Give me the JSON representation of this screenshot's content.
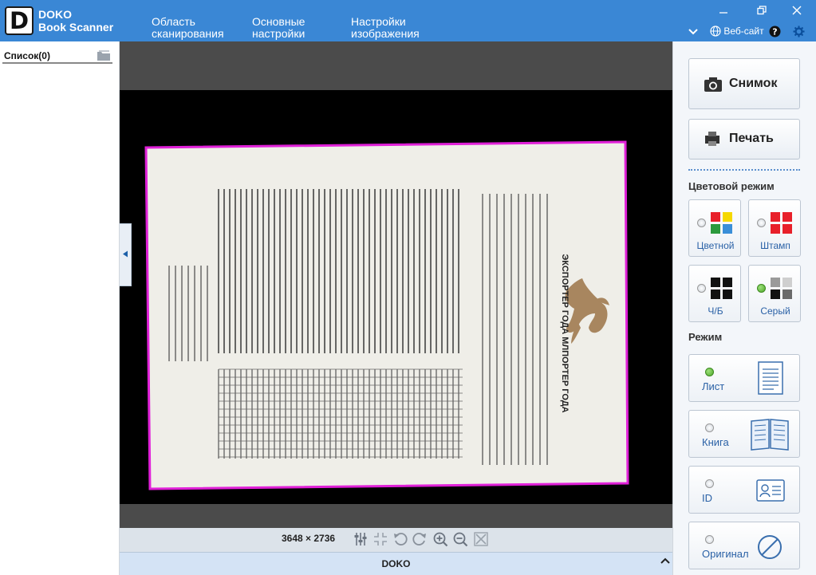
{
  "app": {
    "logo_letter": "D",
    "name_line1": "DOKO",
    "name_line2": "Book Scanner"
  },
  "menu": [
    {
      "line1": "Область",
      "line2": "сканирования"
    },
    {
      "line1": "Основные",
      "line2": "настройки"
    },
    {
      "line1": "Настройки",
      "line2": "изображения"
    }
  ],
  "titlebar_right": {
    "website_label": "Веб-сайт"
  },
  "list": {
    "label": "Список(0)"
  },
  "viewer": {
    "resolution": "3648 × 2736",
    "status": "DOKO"
  },
  "actions": {
    "capture_label": "Снимок",
    "print_label": "Печать"
  },
  "color_mode": {
    "title": "Цветовой режим",
    "options": [
      {
        "label": "Цветной",
        "selected": false
      },
      {
        "label": "Штамп",
        "selected": false
      },
      {
        "label": "Ч/Б",
        "selected": false
      },
      {
        "label": "Серый",
        "selected": true
      }
    ]
  },
  "mode": {
    "title": "Режим",
    "options": [
      {
        "label": "Лист",
        "selected": true
      },
      {
        "label": "Книга",
        "selected": false
      },
      {
        "label": "ID",
        "selected": false
      },
      {
        "label": "Оригинал",
        "selected": false
      }
    ]
  },
  "document_preview": {
    "heading": "ЭКСПОРТЕР ГОДА МЛПОРТЕР ГОДА"
  },
  "colors": {
    "titlebar": "#3a87d5",
    "crop_frame": "#e020d8",
    "accent": "#2a61a6"
  }
}
